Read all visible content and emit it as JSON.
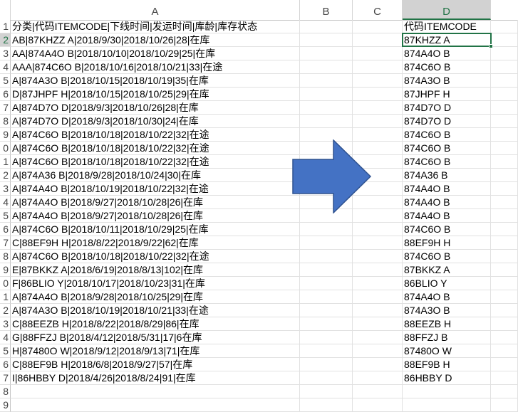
{
  "columns": [
    "A",
    "B",
    "C",
    "D"
  ],
  "active_column": "D",
  "rows": [
    {
      "num": "1",
      "a": "分类|代码ITEMCODE|下线时间|发运时间|库龄|库存状态",
      "d": "代码ITEMCODE"
    },
    {
      "num": "2",
      "a": "AB|87KHZZ A|2018/9/30|2018/10/26|28|在库",
      "d": "87KHZZ A"
    },
    {
      "num": "3",
      "a": "AA|874A4O B|2018/10/10|2018/10/29|25|在库",
      "d": "874A4O B"
    },
    {
      "num": "4",
      "a": "AAA|874C6O B|2018/10/16|2018/10/21|33|在途",
      "d": "874C6O B"
    },
    {
      "num": "5",
      "a": "A|874A3O B|2018/10/15|2018/10/19|35|在库",
      "d": "874A3O B"
    },
    {
      "num": "6",
      "a": "D|87JHPF H|2018/10/15|2018/10/25|29|在库",
      "d": "87JHPF H"
    },
    {
      "num": "7",
      "a": "A|874D7O D|2018/9/3|2018/10/26|28|在库",
      "d": "874D7O D"
    },
    {
      "num": "8",
      "a": "A|874D7O D|2018/9/3|2018/10/30|24|在库",
      "d": "874D7O D"
    },
    {
      "num": "9",
      "a": "A|874C6O B|2018/10/18|2018/10/22|32|在途",
      "d": "874C6O B"
    },
    {
      "num": "0",
      "a": "A|874C6O B|2018/10/18|2018/10/22|32|在途",
      "d": "874C6O B"
    },
    {
      "num": "1",
      "a": "A|874C6O B|2018/10/18|2018/10/22|32|在途",
      "d": "874C6O B"
    },
    {
      "num": "2",
      "a": "A|874A36 B|2018/9/28|2018/10/24|30|在库",
      "d": "874A36 B"
    },
    {
      "num": "3",
      "a": "A|874A4O B|2018/10/19|2018/10/22|32|在途",
      "d": "874A4O B"
    },
    {
      "num": "4",
      "a": "A|874A4O B|2018/9/27|2018/10/28|26|在库",
      "d": "874A4O B"
    },
    {
      "num": "5",
      "a": "A|874A4O B|2018/9/27|2018/10/28|26|在库",
      "d": "874A4O B"
    },
    {
      "num": "6",
      "a": "A|874C6O B|2018/10/11|2018/10/29|25|在库",
      "d": "874C6O B"
    },
    {
      "num": "7",
      "a": "C|88EF9H H|2018/8/22|2018/9/22|62|在库",
      "d": "88EF9H H"
    },
    {
      "num": "8",
      "a": "A|874C6O B|2018/10/18|2018/10/22|32|在途",
      "d": "874C6O B"
    },
    {
      "num": "9",
      "a": "E|87BKKZ A|2018/6/19|2018/8/13|102|在库",
      "d": "87BKKZ A"
    },
    {
      "num": "0",
      "a": "F|86BLIO Y|2018/10/17|2018/10/23|31|在库",
      "d": "86BLIO Y"
    },
    {
      "num": "1",
      "a": "A|874A4O B|2018/9/28|2018/10/25|29|在库",
      "d": "874A4O B"
    },
    {
      "num": "2",
      "a": "A|874A3O B|2018/10/19|2018/10/21|33|在途",
      "d": "874A3O B"
    },
    {
      "num": "3",
      "a": "C|88EEZB H|2018/8/22|2018/8/29|86|在库",
      "d": "88EEZB H"
    },
    {
      "num": "4",
      "a": "G|88FFZJ B|2018/4/12|2018/5/31|17|6在库",
      "d": "88FFZJ B"
    },
    {
      "num": "5",
      "a": "H|87480O W|2018/9/12|2018/9/13|71|在库",
      "d": "87480O W"
    },
    {
      "num": "6",
      "a": "C|88EF9B H|2018/6/8|2018/9/27|57|在库",
      "d": "88EF9B H"
    },
    {
      "num": "7",
      "a": "I|86HBBY D|2018/4/26|2018/8/24|91|在库",
      "d": "86HBBY D"
    },
    {
      "num": "8",
      "a": "",
      "d": ""
    },
    {
      "num": "9",
      "a": "",
      "d": ""
    }
  ],
  "colors": {
    "accent": "#217346",
    "arrow": "#4472c4",
    "arrow_stroke": "#2f528f"
  },
  "arrow_icon": "right-arrow-icon"
}
